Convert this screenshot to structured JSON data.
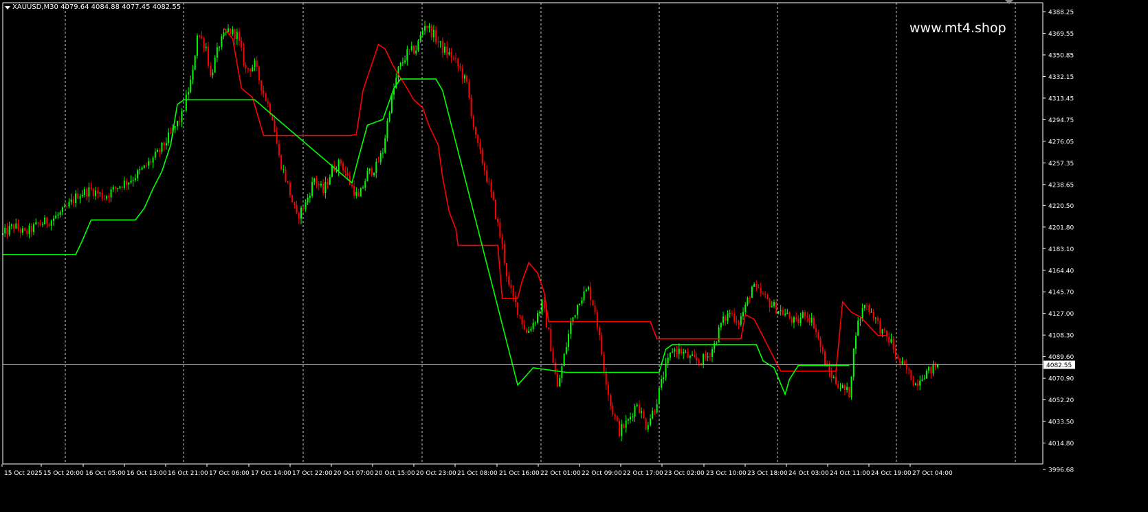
{
  "header": {
    "symbol": "XAUUSD,M30",
    "ohlc": "4079.64 4084.88 4077.45 4082.55"
  },
  "watermark": "www.mt4.shop",
  "colors": {
    "background": "#000000",
    "bull": "#00ff00",
    "bear": "#ff0000",
    "grid": "#c8c8c8",
    "axis": "#ffffff",
    "bid_line": "#bfbfbf"
  },
  "chart_data": {
    "type": "candlestick",
    "symbol": "XAUUSD",
    "timeframe": "M30",
    "last_price": 4082.55,
    "ylim": [
      3996.68,
      4396
    ],
    "y_ticks": [
      4388.25,
      4369.55,
      4350.85,
      4332.15,
      4313.45,
      4294.75,
      4276.05,
      4257.35,
      4238.65,
      4220.5,
      4201.8,
      4183.1,
      4164.4,
      4145.7,
      4127.0,
      4108.3,
      4089.6,
      4070.9,
      4052.2,
      4033.5,
      4014.8,
      3996.68
    ],
    "y_tick_labels": [
      "4388.25",
      "4369.55",
      "4350.85",
      "4332.15",
      "4313.45",
      "4294.75",
      "4276.05",
      "4257.35",
      "4238.65",
      "4220.50",
      "4201.80",
      "4183.10",
      "4164.40",
      "4145.70",
      "4127.00",
      "4108.30",
      "4089.60",
      "4070.90",
      "4052.20",
      "4033.50",
      "4014.80",
      "3996.68"
    ],
    "x_tick_labels": [
      "15 Oct 2025",
      "15 Oct 20:00",
      "16 Oct 05:00",
      "16 Oct 13:00",
      "16 Oct 21:00",
      "17 Oct 06:00",
      "17 Oct 14:00",
      "17 Oct 22:00",
      "20 Oct 07:00",
      "20 Oct 15:00",
      "20 Oct 23:00",
      "21 Oct 08:00",
      "21 Oct 16:00",
      "22 Oct 01:00",
      "22 Oct 09:00",
      "22 Oct 17:00",
      "23 Oct 02:00",
      "23 Oct 10:00",
      "23 Oct 18:00",
      "24 Oct 03:00",
      "24 Oct 11:00",
      "24 Oct 19:00",
      "27 Oct 04:00"
    ],
    "day_separators": [
      "15 Oct",
      "16 Oct",
      "17 Oct",
      "17 Oct late",
      "20 Oct",
      "20 Oct late",
      "21 Oct",
      "21 Oct late",
      "22 Oct",
      "22 Oct late",
      "23 Oct",
      "23 Oct late",
      "24 Oct",
      "24 Oct late",
      "27 Oct",
      "27 Oct late"
    ],
    "price_path": [
      [
        0,
        4195
      ],
      [
        5,
        4203
      ],
      [
        10,
        4196
      ],
      [
        16,
        4204
      ],
      [
        22,
        4208
      ],
      [
        28,
        4216
      ],
      [
        34,
        4230
      ],
      [
        40,
        4234
      ],
      [
        46,
        4228
      ],
      [
        52,
        4237
      ],
      [
        58,
        4243
      ],
      [
        64,
        4253
      ],
      [
        70,
        4265
      ],
      [
        76,
        4282
      ],
      [
        81,
        4298
      ],
      [
        86,
        4335
      ],
      [
        88,
        4370
      ],
      [
        92,
        4358
      ],
      [
        94,
        4332
      ],
      [
        98,
        4360
      ],
      [
        102,
        4372
      ],
      [
        106,
        4368
      ],
      [
        110,
        4338
      ],
      [
        114,
        4342
      ],
      [
        118,
        4318
      ],
      [
        122,
        4298
      ],
      [
        125,
        4262
      ],
      [
        129,
        4238
      ],
      [
        133,
        4210
      ],
      [
        137,
        4222
      ],
      [
        141,
        4244
      ],
      [
        145,
        4232
      ],
      [
        149,
        4252
      ],
      [
        153,
        4258
      ],
      [
        157,
        4240
      ],
      [
        161,
        4226
      ],
      [
        165,
        4248
      ],
      [
        169,
        4254
      ],
      [
        172,
        4268
      ],
      [
        175,
        4305
      ],
      [
        179,
        4338
      ],
      [
        183,
        4352
      ],
      [
        187,
        4356
      ],
      [
        191,
        4378
      ],
      [
        195,
        4368
      ],
      [
        199,
        4356
      ],
      [
        203,
        4350
      ],
      [
        207,
        4338
      ],
      [
        210,
        4325
      ],
      [
        214,
        4278
      ],
      [
        218,
        4252
      ],
      [
        222,
        4222
      ],
      [
        226,
        4185
      ],
      [
        229,
        4150
      ],
      [
        233,
        4130
      ],
      [
        237,
        4110
      ],
      [
        241,
        4122
      ],
      [
        244,
        4135
      ],
      [
        247,
        4110
      ],
      [
        251,
        4062
      ],
      [
        254,
        4090
      ],
      [
        257,
        4118
      ],
      [
        261,
        4140
      ],
      [
        265,
        4148
      ],
      [
        268,
        4130
      ],
      [
        272,
        4080
      ],
      [
        275,
        4048
      ],
      [
        279,
        4025
      ],
      [
        283,
        4034
      ],
      [
        287,
        4050
      ],
      [
        291,
        4030
      ],
      [
        295,
        4045
      ],
      [
        299,
        4074
      ],
      [
        303,
        4096
      ],
      [
        307,
        4094
      ],
      [
        311,
        4088
      ],
      [
        315,
        4085
      ],
      [
        319,
        4090
      ],
      [
        322,
        4100
      ],
      [
        325,
        4118
      ],
      [
        329,
        4128
      ],
      [
        333,
        4120
      ],
      [
        336,
        4132
      ],
      [
        339,
        4150
      ],
      [
        343,
        4144
      ],
      [
        347,
        4136
      ],
      [
        351,
        4130
      ],
      [
        355,
        4125
      ],
      [
        359,
        4118
      ],
      [
        363,
        4128
      ],
      [
        367,
        4118
      ],
      [
        370,
        4098
      ],
      [
        373,
        4078
      ],
      [
        377,
        4068
      ],
      [
        380,
        4062
      ],
      [
        383,
        4058
      ],
      [
        386,
        4112
      ],
      [
        390,
        4136
      ],
      [
        394,
        4126
      ],
      [
        398,
        4110
      ],
      [
        402,
        4102
      ],
      [
        405,
        4086
      ],
      [
        409,
        4078
      ],
      [
        413,
        4066
      ],
      [
        416,
        4074
      ],
      [
        420,
        4078
      ],
      [
        423,
        4082.55
      ]
    ],
    "indicator": {
      "upper_red": [
        [
          100,
          4374
        ],
        [
          104,
          4365
        ],
        [
          108,
          4322
        ],
        [
          113,
          4314
        ],
        [
          118,
          4281
        ],
        [
          157,
          4281
        ],
        [
          160,
          4282
        ],
        [
          163,
          4320
        ],
        [
          170,
          4360
        ],
        [
          173,
          4356
        ],
        [
          177,
          4340
        ],
        [
          182,
          4325
        ],
        [
          186,
          4312
        ],
        [
          190,
          4305
        ],
        [
          193,
          4289
        ],
        [
          197,
          4273
        ],
        [
          199,
          4245
        ],
        [
          202,
          4215
        ],
        [
          205,
          4200
        ],
        [
          206,
          4186
        ],
        [
          224,
          4186
        ],
        [
          226,
          4140
        ],
        [
          233,
          4140
        ],
        [
          235,
          4155
        ],
        [
          238,
          4171
        ],
        [
          242,
          4162
        ],
        [
          245,
          4145
        ],
        [
          247,
          4120
        ],
        [
          293,
          4120
        ],
        [
          296,
          4105
        ],
        [
          334,
          4105
        ],
        [
          336,
          4126
        ],
        [
          340,
          4122
        ],
        [
          344,
          4107
        ],
        [
          348,
          4092
        ],
        [
          352,
          4077
        ],
        [
          377,
          4077
        ],
        [
          380,
          4137
        ],
        [
          384,
          4128
        ],
        [
          388,
          4124
        ],
        [
          392,
          4116
        ],
        [
          396,
          4108
        ],
        [
          400,
          4108
        ]
      ],
      "lower_green": [
        [
          0,
          4178
        ],
        [
          33,
          4178
        ],
        [
          36,
          4190
        ],
        [
          40,
          4208
        ],
        [
          60,
          4208
        ],
        [
          64,
          4218
        ],
        [
          68,
          4235
        ],
        [
          72,
          4250
        ],
        [
          76,
          4273
        ],
        [
          79,
          4308
        ],
        [
          82,
          4312
        ],
        [
          105,
          4312
        ],
        [
          114,
          4312
        ],
        [
          158,
          4240
        ],
        [
          161,
          4262
        ],
        [
          165,
          4290
        ],
        [
          172,
          4295
        ],
        [
          177,
          4322
        ],
        [
          180,
          4330
        ],
        [
          196,
          4330
        ],
        [
          199,
          4320
        ],
        [
          233,
          4065
        ],
        [
          240,
          4080
        ],
        [
          255,
          4076
        ],
        [
          297,
          4076
        ],
        [
          300,
          4096
        ],
        [
          303,
          4100
        ],
        [
          341,
          4100
        ],
        [
          344,
          4086
        ],
        [
          349,
          4080
        ],
        [
          354,
          4057
        ],
        [
          356,
          4070
        ],
        [
          360,
          4082
        ],
        [
          383,
          4082
        ]
      ]
    }
  }
}
